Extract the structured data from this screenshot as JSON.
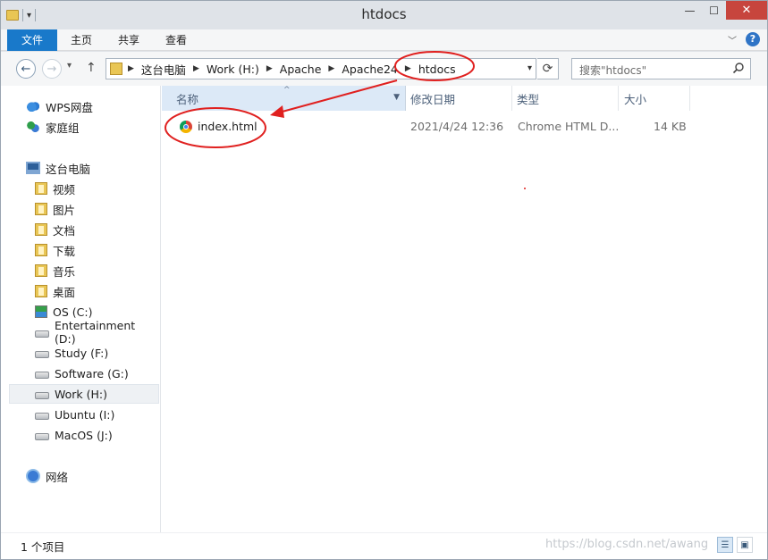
{
  "window": {
    "title": "htdocs"
  },
  "ribbon": {
    "tabs": [
      "文件",
      "主页",
      "共享",
      "查看"
    ]
  },
  "address": {
    "crumbs": [
      "这台电脑",
      "Work (H:)",
      "Apache",
      "Apache24",
      "htdocs"
    ]
  },
  "search": {
    "placeholder": "搜索\"htdocs\""
  },
  "sidebar": {
    "items": [
      {
        "label": "WPS网盘",
        "icon": "cloud-icon"
      },
      {
        "label": "家庭组",
        "icon": "homegroup-icon"
      },
      {
        "label": "这台电脑",
        "icon": "computer-icon"
      },
      {
        "label": "视频",
        "icon": "library-icon"
      },
      {
        "label": "图片",
        "icon": "library-icon"
      },
      {
        "label": "文档",
        "icon": "library-icon"
      },
      {
        "label": "下载",
        "icon": "library-icon"
      },
      {
        "label": "音乐",
        "icon": "library-icon"
      },
      {
        "label": "桌面",
        "icon": "library-icon"
      },
      {
        "label": "OS (C:)",
        "icon": "os-drive-icon"
      },
      {
        "label": "Entertainment (D:)",
        "icon": "drive-icon"
      },
      {
        "label": "Study (F:)",
        "icon": "drive-icon"
      },
      {
        "label": "Software (G:)",
        "icon": "drive-icon"
      },
      {
        "label": "Work (H:)",
        "icon": "drive-icon",
        "selected": true
      },
      {
        "label": "Ubuntu (I:)",
        "icon": "drive-icon"
      },
      {
        "label": "MacOS (J:)",
        "icon": "drive-icon"
      },
      {
        "label": "网络",
        "icon": "network-icon"
      }
    ]
  },
  "columns": {
    "name": "名称",
    "modified": "修改日期",
    "type": "类型",
    "size": "大小"
  },
  "files": [
    {
      "name": "index.html",
      "modified": "2021/4/24 12:36",
      "type": "Chrome HTML D...",
      "size": "14 KB",
      "icon": "chrome-icon"
    }
  ],
  "status": {
    "count": "1 个项目"
  },
  "watermark": "https://blog.csdn.net/awang",
  "annotation_color": "#e0201f"
}
